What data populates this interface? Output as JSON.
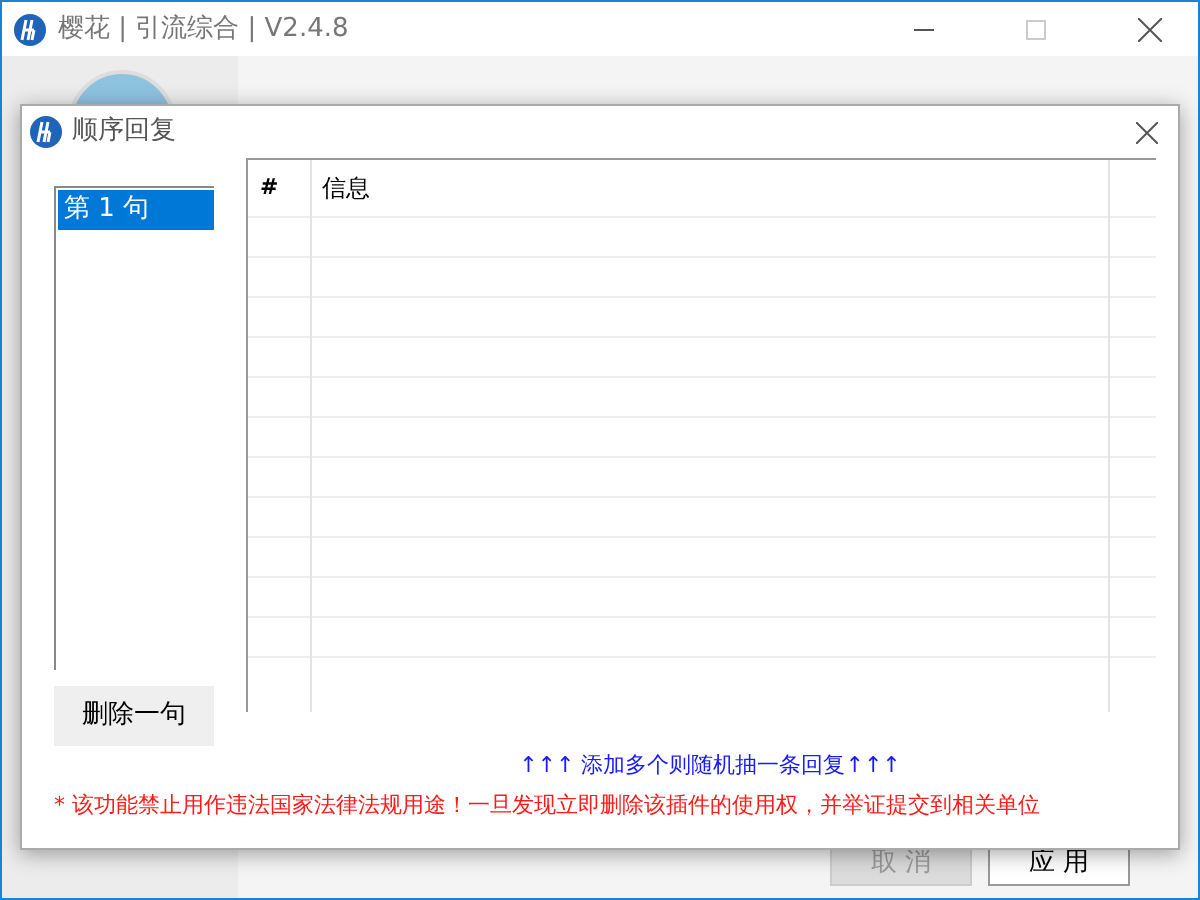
{
  "main_window": {
    "title": "樱花 | 引流综合 | V2.4.8",
    "buttons": [
      {
        "label": "取 消",
        "kind": "secondary"
      },
      {
        "label": "应 用",
        "kind": "primary"
      }
    ]
  },
  "dialog": {
    "title": "顺序回复",
    "sentences": [
      {
        "label": "第 1 句",
        "selected": true
      }
    ],
    "delete_button": "删除一句",
    "table": {
      "columns": [
        "#",
        "信息"
      ]
    },
    "hint": "↑↑↑ 添加多个则随机抽一条回复↑↑↑",
    "warning": "* 该功能禁止用作违法国家法律法规用途！一旦发现立即删除该插件的使用权，并举证提交到相关单位"
  }
}
